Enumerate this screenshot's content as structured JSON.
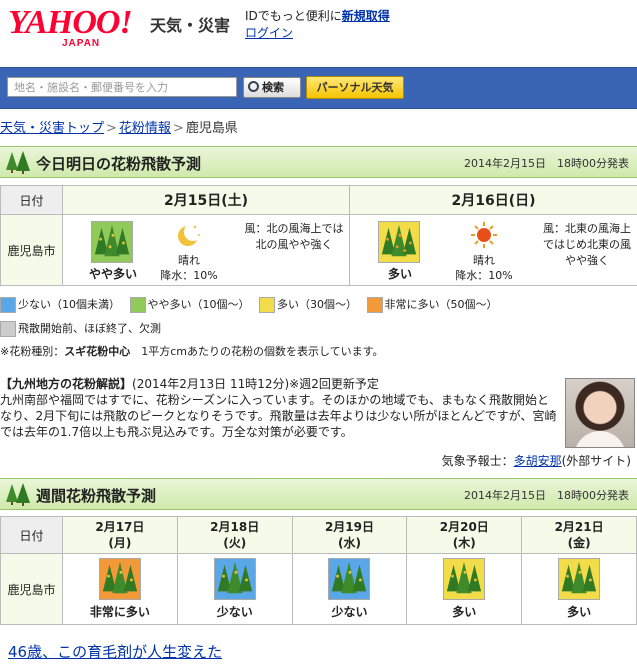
{
  "header": {
    "logo": "YAHOO!",
    "logo_sub": "JAPAN",
    "service": "天気・災害",
    "login_prompt": "IDでもっと便利に",
    "register": "新規取得",
    "login": "ログイン"
  },
  "search": {
    "placeholder": "地名・施設名・郵便番号を入力",
    "button": "検索",
    "personal": "パーソナル天気"
  },
  "breadcrumb": {
    "top": "天気・災害トップ",
    "pollen": "花粉情報",
    "current": "鹿児島県"
  },
  "today": {
    "title": "今日明日の花粉飛散予測",
    "issued": "2014年2月15日　18時00分発表",
    "label_date": "日付",
    "region": "鹿児島市",
    "days": [
      {
        "date": "2月15日(土)",
        "pollen": "やや多い",
        "weather": "晴れ",
        "rain": "降水：10%",
        "wind": "風：北の風海上では北の風やや強く",
        "wx_icon": "moon-icon"
      },
      {
        "date": "2月16日(日)",
        "pollen": "多い",
        "weather": "晴れ",
        "rain": "降水：10%",
        "wind": "風：北東の風海上ではじめ北東の風やや強く",
        "wx_icon": "sun-icon"
      }
    ]
  },
  "legend": {
    "items": [
      "少ない（10個未満）",
      "やや多い（10個〜）",
      "多い（30個〜）",
      "非常に多い（50個〜）"
    ],
    "none": "飛散開始前、ほぼ終了、欠測",
    "note_prefix": "※花粉種別：",
    "note_type": "スギ花粉中心",
    "note_suffix": "1平方cmあたりの花粉の個数を表示しています。"
  },
  "explain": {
    "heading": "【九州地方の花粉解説】",
    "meta": "(2014年2月13日 11時12分)※週2回更新予定",
    "body": "九州南部や福岡ではすでに、花粉シーズンに入っています。そのほかの地域でも、まもなく飛散開始となり、2月下旬には飛散のピークとなりそうです。飛散量は去年よりは少ない所がほとんどですが、宮崎では去年の1.7倍以上も飛ぶ見込みです。万全な対策が必要です。",
    "forecaster_prefix": "気象予報士：",
    "forecaster": "多胡安那",
    "forecaster_suffix": "(外部サイト)"
  },
  "week": {
    "title": "週間花粉飛散予測",
    "issued": "2014年2月15日　18時00分発表",
    "label_date": "日付",
    "region": "鹿児島市",
    "days": [
      {
        "date": "2月17日",
        "dow": "(月)",
        "pollen": "非常に多い",
        "level": 4
      },
      {
        "date": "2月18日",
        "dow": "(火)",
        "pollen": "少ない",
        "level": 1
      },
      {
        "date": "2月19日",
        "dow": "(水)",
        "pollen": "少ない",
        "level": 1
      },
      {
        "date": "2月20日",
        "dow": "(木)",
        "pollen": "多い",
        "level": 3
      },
      {
        "date": "2月21日",
        "dow": "(金)",
        "pollen": "多い",
        "level": 3
      }
    ]
  },
  "ad": {
    "text": "46歳、この育毛剤が人生変えた"
  },
  "colors": {
    "level1": "#5aa7e8",
    "level2": "#8fca5a",
    "level3": "#f2dc4a",
    "level4": "#f29a3a",
    "none": "#cccccc",
    "head": "#cfe9ac"
  }
}
